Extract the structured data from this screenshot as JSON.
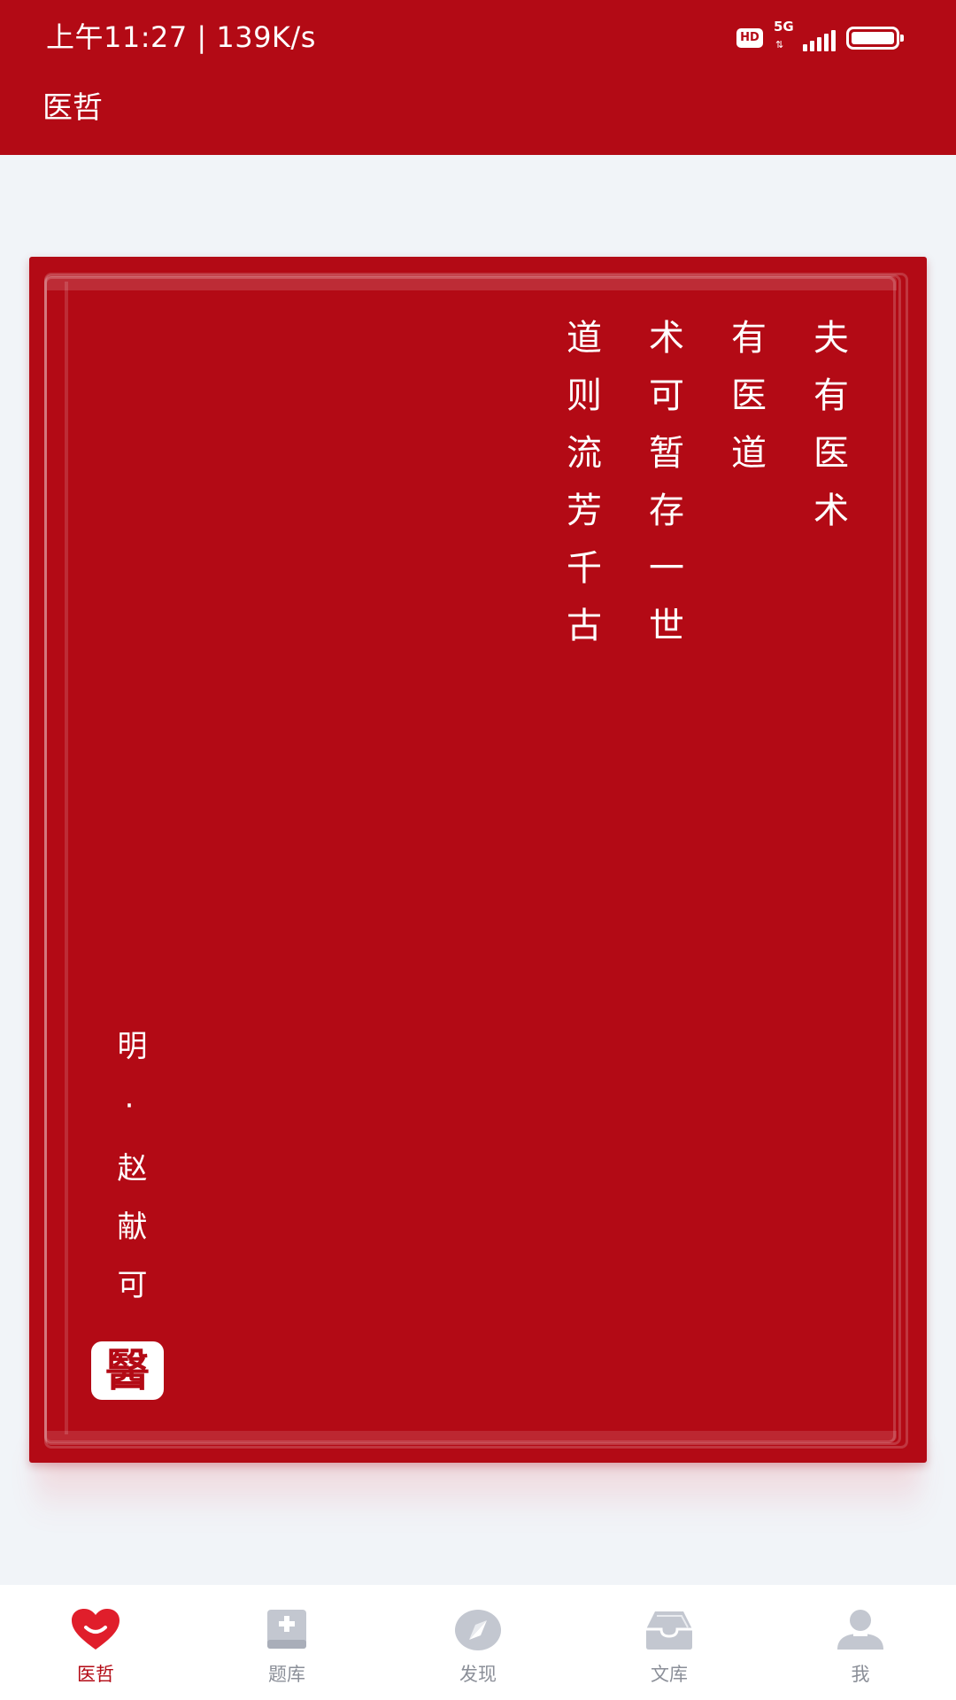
{
  "status_bar": {
    "time": "上午11:27 | 139K/s",
    "hd_badge": "HD",
    "network": "5G",
    "battery_level": 1.0
  },
  "header": {
    "title": "医哲"
  },
  "card": {
    "poem_columns": [
      "夫有医术",
      "有医道",
      "术可暂存一世",
      "道则流芳千古"
    ],
    "author": "明·赵献可",
    "seal_text": "醫"
  },
  "bottom_nav": {
    "active_index": 0,
    "items": [
      {
        "label": "医哲",
        "icon": "heart-smile-icon"
      },
      {
        "label": "题库",
        "icon": "question-bank-icon"
      },
      {
        "label": "发现",
        "icon": "compass-icon"
      },
      {
        "label": "文库",
        "icon": "inbox-tray-icon"
      },
      {
        "label": "我",
        "icon": "user-icon"
      }
    ]
  },
  "colors": {
    "brand_red": "#b30a15",
    "background": "#f1f4f8",
    "nav_inactive": "#8b8f98"
  }
}
